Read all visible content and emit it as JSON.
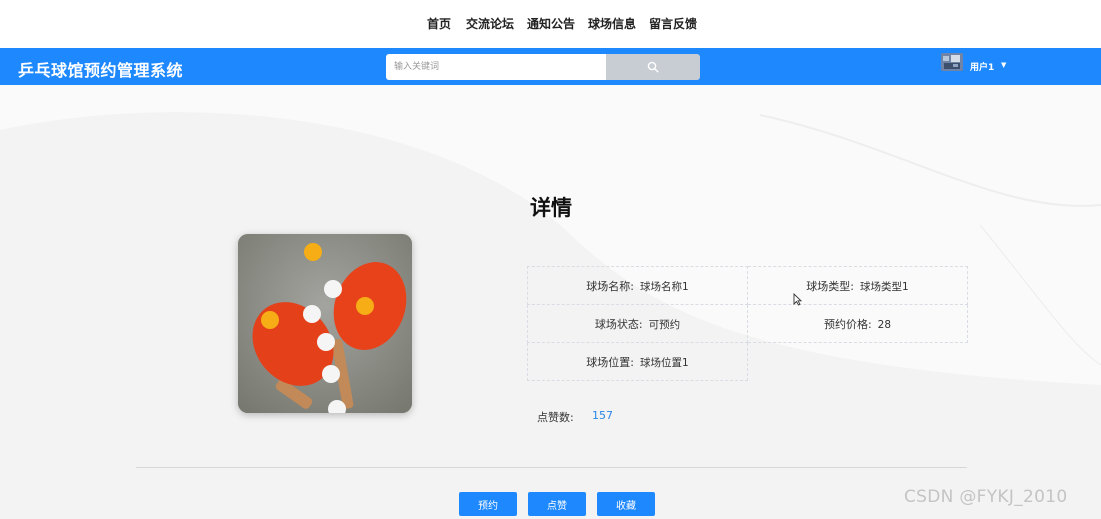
{
  "top_nav": [
    "首页",
    "交流论坛",
    "通知公告",
    "球场信息",
    "留言反馈"
  ],
  "header": {
    "brand": "乒乓球馆预约管理系统",
    "search_placeholder": "输入关键词",
    "user_name": "用户1",
    "accent_color": "#1e88ff"
  },
  "detail": {
    "title": "详情",
    "fields": {
      "name_label": "球场名称:",
      "name_value": "球场名称1",
      "type_label": "球场类型:",
      "type_value": "球场类型1",
      "status_label": "球场状态:",
      "status_value": "可预约",
      "price_label": "预约价格:",
      "price_value": "28",
      "location_label": "球场位置:",
      "location_value": "球场位置1"
    },
    "likes_label": "点赞数:",
    "likes_value": "157"
  },
  "actions": {
    "book": "预约",
    "like": "点赞",
    "favorite": "收藏"
  },
  "watermark": "CSDN @FYKJ_2010"
}
